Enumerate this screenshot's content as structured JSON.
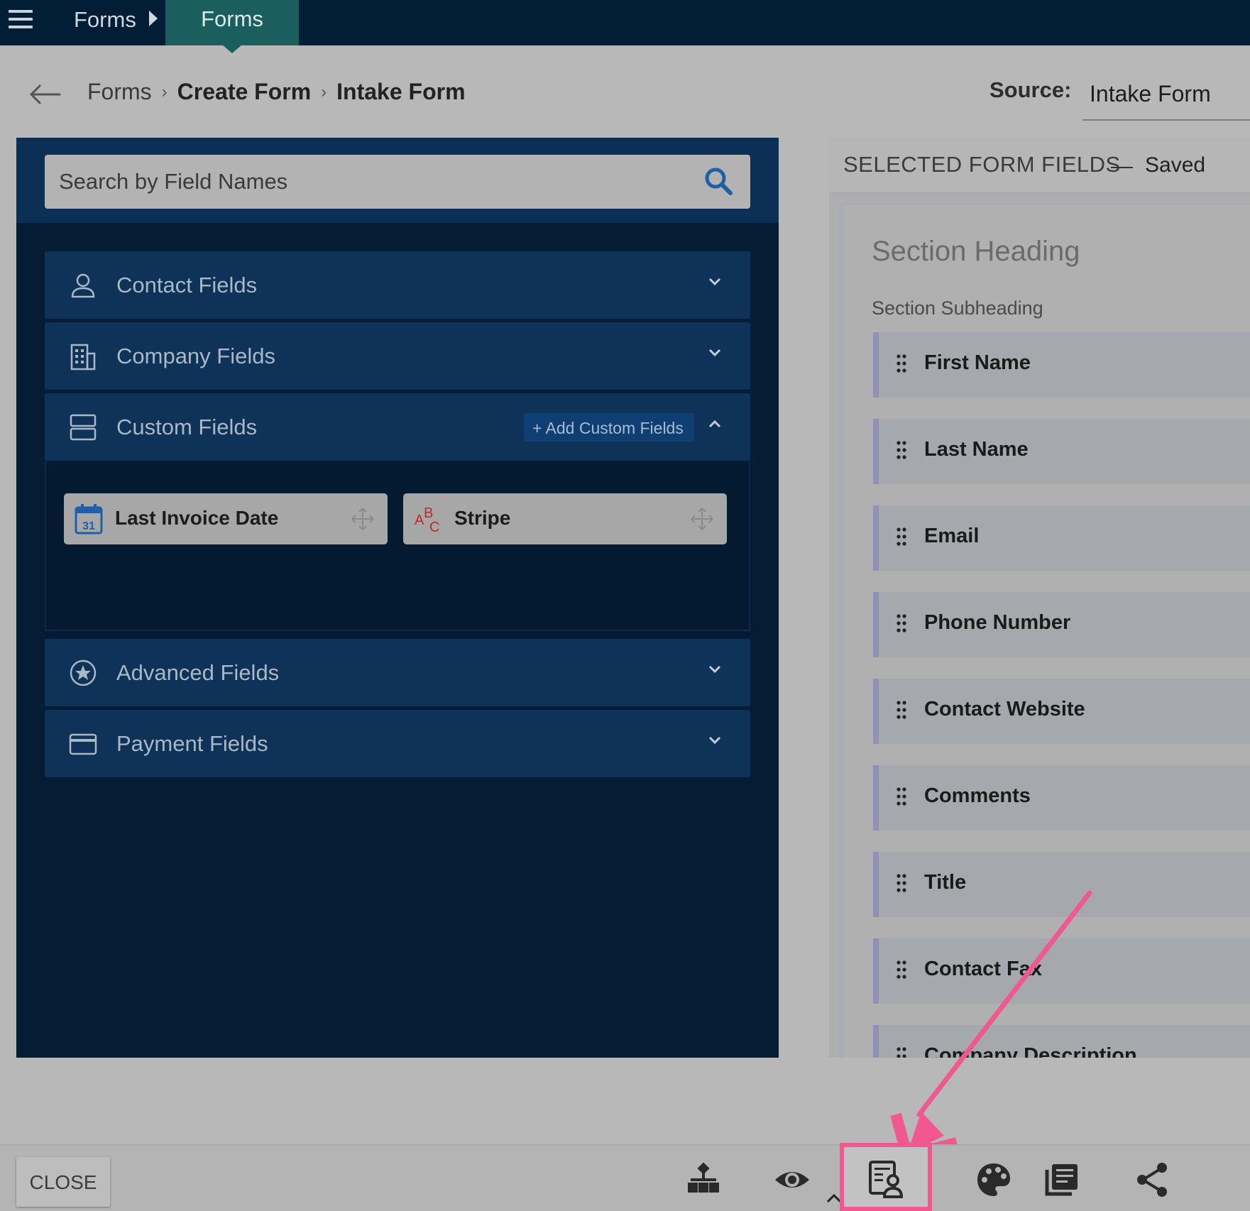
{
  "topbar": {
    "crumb": "Forms",
    "tab": "Forms"
  },
  "breadcrumb": {
    "items": [
      "Forms",
      "Create Form",
      "Intake Form"
    ]
  },
  "source": {
    "label": "Source:",
    "value": "Intake Form"
  },
  "search": {
    "placeholder": "Search by Field Names"
  },
  "categories": {
    "contact": "Contact Fields",
    "company": "Company Fields",
    "custom": "Custom Fields",
    "add_custom": "+ Add Custom Fields",
    "advanced": "Advanced Fields",
    "payment": "Payment Fields"
  },
  "custom_fields": [
    {
      "label": "Last Invoice Date",
      "icon": "calendar-icon",
      "icon_text": "31"
    },
    {
      "label": "Stripe",
      "icon": "text-field-icon",
      "icon_text": "ABC"
    }
  ],
  "selected": {
    "title": "SELECTED FORM FIELDS",
    "dash": "—",
    "status": "Saved",
    "section_heading": "Section Heading",
    "section_subheading": "Section Subheading",
    "fields": [
      "First Name",
      "Last Name",
      "Email",
      "Phone Number",
      "Contact Website",
      "Comments",
      "Title",
      "Contact Fax",
      "Company Description"
    ]
  },
  "bottombar": {
    "close": "CLOSE",
    "tools": [
      "hierarchy-icon",
      "eye-icon",
      "form-settings-icon",
      "palette-icon",
      "library-icon",
      "share-icon"
    ]
  },
  "colors": {
    "highlight": "#f0588f",
    "topbar": "#021d36",
    "active_tab": "#1a5f5e",
    "panel": "#041d34"
  }
}
